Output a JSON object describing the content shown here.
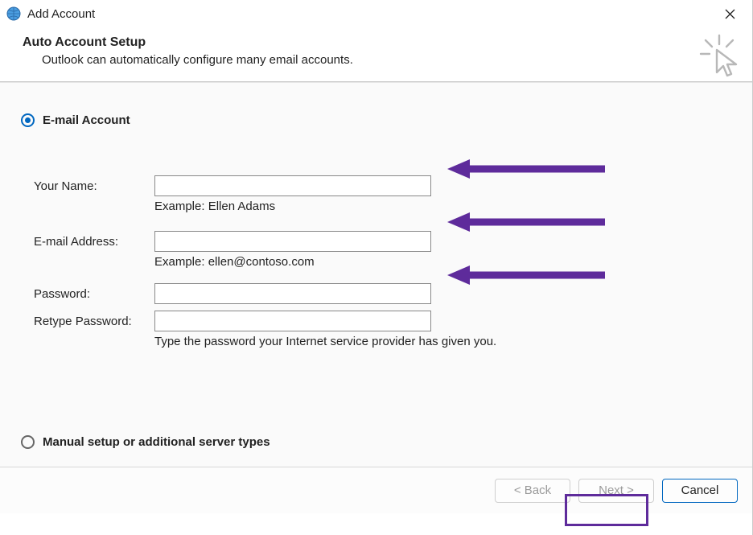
{
  "window": {
    "title": "Add Account"
  },
  "header": {
    "title": "Auto Account Setup",
    "subtitle": "Outlook can automatically configure many email accounts."
  },
  "options": {
    "email_account": {
      "label": "E-mail Account",
      "selected": true
    },
    "manual": {
      "label": "Manual setup or additional server types",
      "selected": false
    }
  },
  "fields": {
    "name": {
      "label": "Your Name:",
      "value": "",
      "hint": "Example: Ellen Adams"
    },
    "email": {
      "label": "E-mail Address:",
      "value": "",
      "hint": "Example: ellen@contoso.com"
    },
    "password": {
      "label": "Password:",
      "value": ""
    },
    "retype": {
      "label": "Retype Password:",
      "value": "",
      "hint": "Type the password your Internet service provider has given you."
    }
  },
  "buttons": {
    "back": "< Back",
    "next": "Next >",
    "cancel": "Cancel"
  },
  "annotations": {
    "arrow_color": "#5e2b9b"
  }
}
